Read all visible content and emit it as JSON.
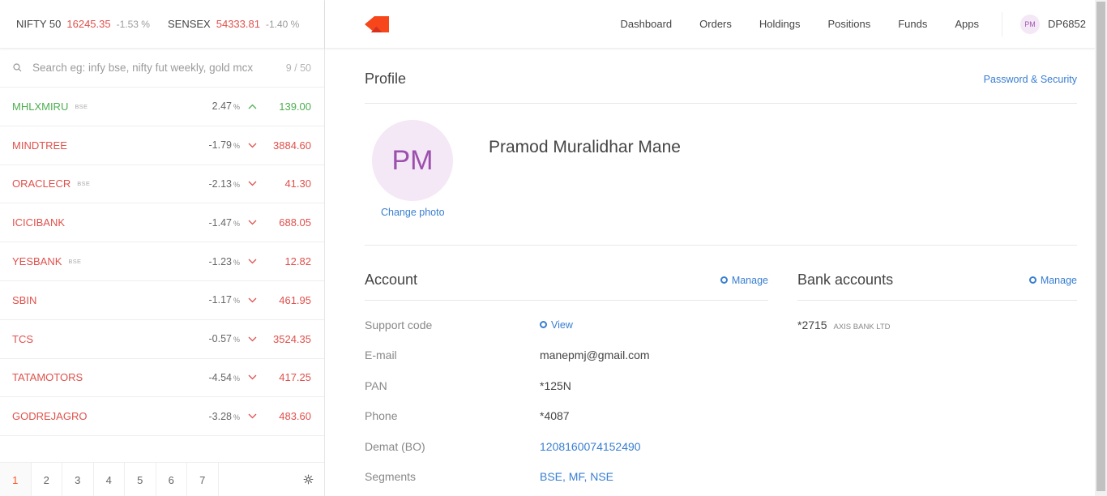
{
  "indices": [
    {
      "name": "NIFTY 50",
      "value": "16245.35",
      "change": "-1.53 %"
    },
    {
      "name": "SENSEX",
      "value": "54333.81",
      "change": "-1.40 %"
    }
  ],
  "search": {
    "placeholder": "Search eg: infy bse, nifty fut weekly, gold mcx",
    "count": "9 / 50"
  },
  "watchlist": [
    {
      "symbol": "MHLXMIRU",
      "exchange": "BSE",
      "change": "2.47",
      "pct": "%",
      "price": "139.00",
      "direction": "up"
    },
    {
      "symbol": "MINDTREE",
      "exchange": "",
      "change": "-1.79",
      "pct": "%",
      "price": "3884.60",
      "direction": "down"
    },
    {
      "symbol": "ORACLECR",
      "exchange": "BSE",
      "change": "-2.13",
      "pct": "%",
      "price": "41.30",
      "direction": "down"
    },
    {
      "symbol": "ICICIBANK",
      "exchange": "",
      "change": "-1.47",
      "pct": "%",
      "price": "688.05",
      "direction": "down"
    },
    {
      "symbol": "YESBANK",
      "exchange": "BSE",
      "change": "-1.23",
      "pct": "%",
      "price": "12.82",
      "direction": "down"
    },
    {
      "symbol": "SBIN",
      "exchange": "",
      "change": "-1.17",
      "pct": "%",
      "price": "461.95",
      "direction": "down"
    },
    {
      "symbol": "TCS",
      "exchange": "",
      "change": "-0.57",
      "pct": "%",
      "price": "3524.35",
      "direction": "down"
    },
    {
      "symbol": "TATAMOTORS",
      "exchange": "",
      "change": "-4.54",
      "pct": "%",
      "price": "417.25",
      "direction": "down"
    },
    {
      "symbol": "GODREJAGRO",
      "exchange": "",
      "change": "-3.28",
      "pct": "%",
      "price": "483.60",
      "direction": "down"
    }
  ],
  "pager": {
    "pages": [
      "1",
      "2",
      "3",
      "4",
      "5",
      "6",
      "7"
    ],
    "active": "1"
  },
  "nav": {
    "items": [
      "Dashboard",
      "Orders",
      "Holdings",
      "Positions",
      "Funds",
      "Apps"
    ],
    "user_initials": "PM",
    "user_id": "DP6852"
  },
  "profile": {
    "title": "Profile",
    "password_link": "Password & Security",
    "initials": "PM",
    "change_photo": "Change photo",
    "name": "Pramod Muralidhar Mane"
  },
  "account": {
    "title": "Account",
    "manage": "Manage",
    "rows": [
      {
        "label": "Support code",
        "value": "View"
      },
      {
        "label": "E-mail",
        "value": "manepmj@gmail.com"
      },
      {
        "label": "PAN",
        "value": "*125N"
      },
      {
        "label": "Phone",
        "value": "*4087"
      },
      {
        "label": "Demat (BO)",
        "value": "1208160074152490"
      },
      {
        "label": "Segments",
        "value": "BSE, MF, NSE"
      }
    ]
  },
  "bank": {
    "title": "Bank accounts",
    "manage": "Manage",
    "account_no": "*2715",
    "bank_name": "AXIS BANK LTD"
  },
  "colors": {
    "accent": "#387ed1",
    "negative": "#df514c",
    "positive": "#4caf50",
    "brand": "#ff5722"
  }
}
